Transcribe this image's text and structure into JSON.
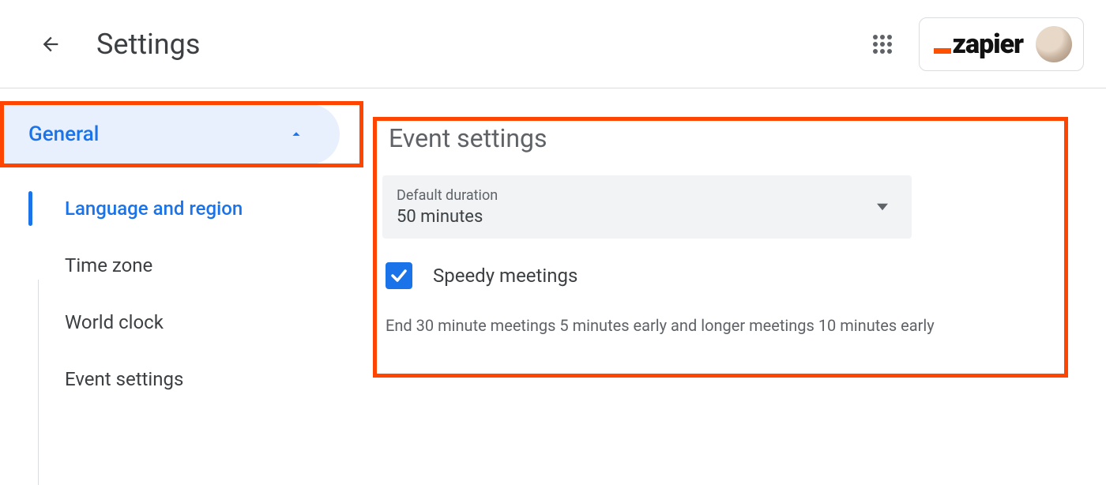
{
  "header": {
    "title": "Settings",
    "brand": "zapier"
  },
  "sidebar": {
    "section": "General",
    "items": [
      "Language and region",
      "Time zone",
      "World clock",
      "Event settings"
    ],
    "active_index": 0
  },
  "content": {
    "title": "Event settings",
    "select": {
      "label": "Default duration",
      "value": "50 minutes"
    },
    "checkbox": {
      "label": "Speedy meetings",
      "checked": true
    },
    "helper": "End 30 minute meetings 5 minutes early and longer meetings 10 minutes early"
  }
}
